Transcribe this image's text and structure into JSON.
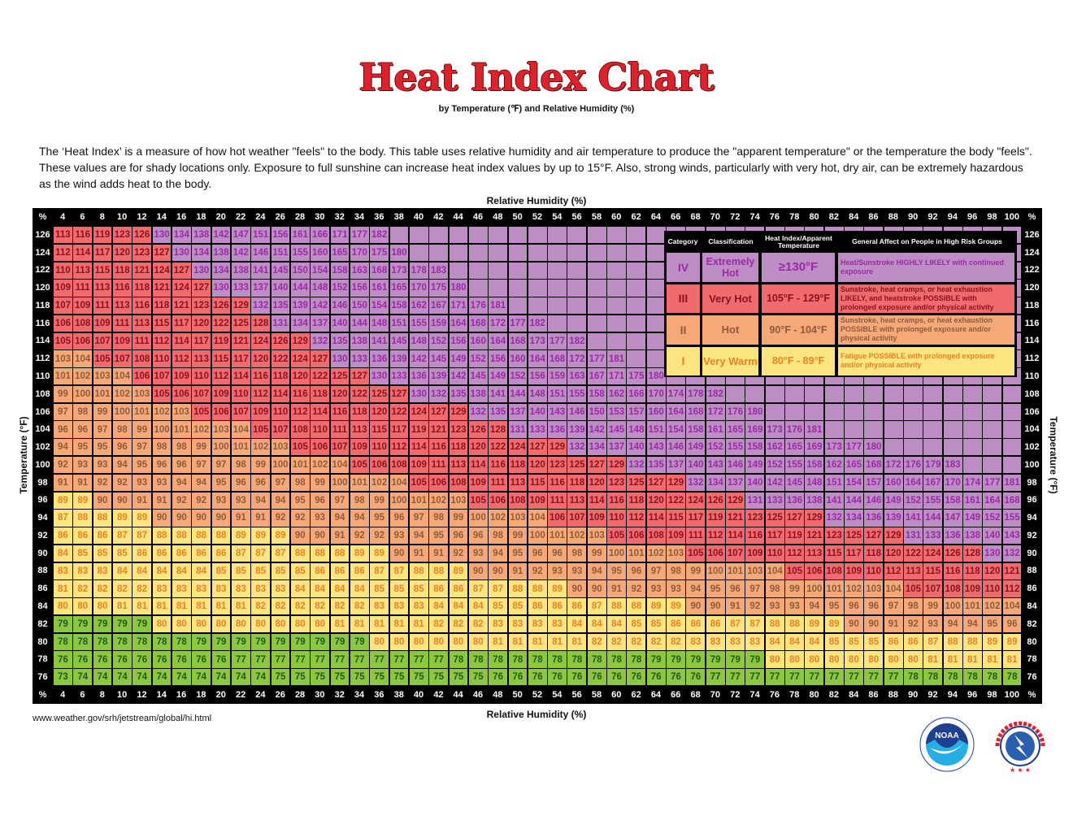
{
  "title": "Heat Index Chart",
  "subtitle": "by Temperature (℉) and Relative Humidity (%)",
  "intro": "The ‘Heat Index’ is a measure of how hot weather \"feels\" to the body. This table uses relative humidity and air temperature to produce the \"apparent temperature\" or the temperature the body \"feels\". These values are for shady locations only. Exposure to full sunshine can increase heat index values by up to 15°F. Also, strong winds, particularly with very hot, dry air, can be extremely hazardous as the wind adds heat to the body.",
  "source_url": "www.weather.gov/srh/jetstream/global/hi.html",
  "logos": {
    "noaa": "NOAA",
    "noaa_ring": "NATIONAL OCEANIC AND ATMOSPHERIC ADMINISTRATION · U.S. DEPARTMENT OF COMMERCE",
    "nws": "NATIONAL WEATHER SERVICE"
  },
  "colors": {
    "extremely_hot": "#bf8dc6",
    "very_hot": "#ef6b6e",
    "hot": "#f5a978",
    "very_warm": "#fce480",
    "below": "#8dc641"
  },
  "legend": {
    "headers": [
      "Category",
      "Classification",
      "Heat Index/Apparent Temperature",
      "General Affect on People in High Risk Groups"
    ],
    "rows": [
      {
        "category": "IV",
        "classification": "Extremely Hot",
        "range": "≥130°F",
        "effect": "Heat/Sunstroke HIGHLY LIKELY with continued exposure",
        "color": "purple"
      },
      {
        "category": "III",
        "classification": "Very Hot",
        "range": "105°F - 129°F",
        "effect": "Sunstroke, heat cramps, or heat exhaustion LIKELY, and heatstroke POSSIBLE with prolonged exposure and/or physical activity",
        "color": "red"
      },
      {
        "category": "II",
        "classification": "Hot",
        "range": "90°F - 104°F",
        "effect": "Sunstroke, heat cramps, or heat exhaustion POSSIBLE with prolonged exposure and/or physical activity",
        "color": "orange"
      },
      {
        "category": "I",
        "classification": "Very Warm",
        "range": "80°F - 89°F",
        "effect": "Fatigue POSSIBLE with prolonged exposure and/or physical activity",
        "color": "yellow"
      }
    ]
  },
  "chart_data": {
    "type": "heatmap",
    "title": "Heat Index Chart",
    "subtitle": "by Temperature (℉) and Relative Humidity (%)",
    "xlabel": "Relative Humidity (%)",
    "ylabel": "Temperature (°F)",
    "corner_label": "%",
    "humidity": [
      4,
      6,
      8,
      10,
      12,
      14,
      16,
      18,
      20,
      22,
      24,
      26,
      28,
      30,
      32,
      34,
      36,
      38,
      40,
      42,
      44,
      46,
      48,
      50,
      52,
      54,
      56,
      58,
      60,
      62,
      64,
      66,
      68,
      70,
      72,
      74,
      76,
      78,
      80,
      82,
      84,
      86,
      88,
      90,
      92,
      94,
      96,
      98,
      100
    ],
    "rows": [
      {
        "temp": 126,
        "values": [
          113,
          116,
          119,
          123,
          126,
          130,
          134,
          138,
          142,
          147,
          151,
          156,
          161,
          166,
          171,
          177,
          182
        ]
      },
      {
        "temp": 124,
        "values": [
          112,
          114,
          117,
          120,
          123,
          127,
          130,
          134,
          138,
          142,
          146,
          151,
          155,
          160,
          165,
          170,
          175,
          180
        ]
      },
      {
        "temp": 122,
        "values": [
          110,
          113,
          115,
          118,
          121,
          124,
          127,
          130,
          134,
          138,
          141,
          145,
          150,
          154,
          158,
          163,
          168,
          173,
          178,
          183
        ]
      },
      {
        "temp": 120,
        "values": [
          109,
          111,
          113,
          116,
          118,
          121,
          124,
          127,
          130,
          133,
          137,
          140,
          144,
          148,
          152,
          156,
          161,
          165,
          170,
          175,
          180
        ]
      },
      {
        "temp": 118,
        "values": [
          107,
          109,
          111,
          113,
          116,
          118,
          121,
          123,
          126,
          129,
          132,
          135,
          139,
          142,
          146,
          150,
          154,
          158,
          162,
          167,
          171,
          176,
          181
        ]
      },
      {
        "temp": 116,
        "values": [
          106,
          108,
          109,
          111,
          113,
          115,
          117,
          120,
          122,
          125,
          128,
          131,
          134,
          137,
          140,
          144,
          148,
          151,
          155,
          159,
          164,
          168,
          172,
          177,
          182
        ]
      },
      {
        "temp": 114,
        "values": [
          105,
          106,
          107,
          109,
          111,
          112,
          114,
          117,
          119,
          121,
          124,
          126,
          129,
          132,
          135,
          138,
          141,
          145,
          148,
          152,
          156,
          160,
          164,
          168,
          173,
          177,
          182
        ]
      },
      {
        "temp": 112,
        "values": [
          103,
          104,
          105,
          107,
          108,
          110,
          112,
          113,
          115,
          117,
          120,
          122,
          124,
          127,
          130,
          133,
          136,
          139,
          142,
          145,
          149,
          152,
          156,
          160,
          164,
          168,
          172,
          177,
          181
        ]
      },
      {
        "temp": 110,
        "values": [
          101,
          102,
          103,
          104,
          106,
          107,
          109,
          110,
          112,
          114,
          116,
          118,
          120,
          122,
          125,
          127,
          130,
          133,
          136,
          139,
          142,
          145,
          149,
          152,
          156,
          159,
          163,
          167,
          171,
          175,
          180
        ]
      },
      {
        "temp": 108,
        "values": [
          99,
          100,
          101,
          102,
          103,
          105,
          106,
          107,
          109,
          110,
          112,
          114,
          116,
          118,
          120,
          122,
          125,
          127,
          130,
          132,
          135,
          138,
          141,
          144,
          148,
          151,
          155,
          158,
          162,
          166,
          170,
          174,
          178,
          182
        ]
      },
      {
        "temp": 106,
        "values": [
          97,
          98,
          99,
          100,
          101,
          102,
          103,
          105,
          106,
          107,
          109,
          110,
          112,
          114,
          116,
          118,
          120,
          122,
          124,
          127,
          129,
          132,
          135,
          137,
          140,
          143,
          146,
          150,
          153,
          157,
          160,
          164,
          168,
          172,
          176,
          180
        ]
      },
      {
        "temp": 104,
        "values": [
          96,
          96,
          97,
          98,
          99,
          100,
          101,
          102,
          103,
          104,
          105,
          107,
          108,
          110,
          111,
          113,
          115,
          117,
          119,
          121,
          123,
          126,
          128,
          131,
          133,
          136,
          139,
          142,
          145,
          148,
          151,
          154,
          158,
          161,
          165,
          169,
          173,
          176,
          181
        ]
      },
      {
        "temp": 102,
        "values": [
          94,
          95,
          95,
          96,
          97,
          98,
          98,
          99,
          100,
          101,
          102,
          103,
          105,
          106,
          107,
          109,
          110,
          112,
          114,
          116,
          118,
          120,
          122,
          124,
          127,
          129,
          132,
          134,
          137,
          140,
          143,
          146,
          149,
          152,
          155,
          158,
          162,
          165,
          169,
          173,
          177,
          180
        ]
      },
      {
        "temp": 100,
        "values": [
          92,
          93,
          93,
          94,
          95,
          96,
          96,
          97,
          97,
          98,
          99,
          100,
          101,
          102,
          104,
          105,
          106,
          108,
          109,
          111,
          113,
          114,
          116,
          118,
          120,
          123,
          125,
          127,
          129,
          132,
          135,
          137,
          140,
          143,
          146,
          149,
          152,
          155,
          158,
          162,
          165,
          168,
          172,
          176,
          179,
          183
        ]
      },
      {
        "temp": 98,
        "values": [
          91,
          91,
          92,
          92,
          93,
          93,
          94,
          94,
          95,
          96,
          96,
          97,
          98,
          99,
          100,
          101,
          102,
          104,
          105,
          106,
          108,
          109,
          111,
          113,
          115,
          116,
          118,
          120,
          123,
          125,
          127,
          129,
          132,
          134,
          137,
          140,
          142,
          145,
          148,
          151,
          154,
          157,
          160,
          164,
          167,
          170,
          174,
          177,
          181
        ]
      },
      {
        "temp": 96,
        "values": [
          89,
          89,
          90,
          90,
          91,
          91,
          92,
          92,
          93,
          93,
          94,
          94,
          95,
          96,
          97,
          98,
          99,
          100,
          101,
          102,
          103,
          105,
          106,
          108,
          109,
          111,
          113,
          114,
          116,
          118,
          120,
          122,
          124,
          126,
          129,
          131,
          133,
          136,
          138,
          141,
          144,
          146,
          149,
          152,
          155,
          158,
          161,
          164,
          168
        ]
      },
      {
        "temp": 94,
        "values": [
          87,
          88,
          88,
          89,
          89,
          90,
          90,
          90,
          90,
          91,
          91,
          92,
          92,
          93,
          94,
          94,
          95,
          96,
          97,
          98,
          99,
          100,
          102,
          103,
          104,
          106,
          107,
          109,
          110,
          112,
          114,
          115,
          117,
          119,
          121,
          123,
          125,
          127,
          129,
          132,
          134,
          136,
          139,
          141,
          144,
          147,
          149,
          152,
          155
        ]
      },
      {
        "temp": 92,
        "values": [
          86,
          86,
          86,
          87,
          87,
          88,
          88,
          88,
          88,
          89,
          89,
          89,
          90,
          90,
          91,
          92,
          92,
          93,
          94,
          95,
          96,
          96,
          98,
          99,
          100,
          101,
          102,
          103,
          105,
          106,
          108,
          109,
          111,
          112,
          114,
          116,
          117,
          119,
          121,
          123,
          125,
          127,
          129,
          131,
          133,
          136,
          138,
          140,
          143
        ]
      },
      {
        "temp": 90,
        "values": [
          84,
          85,
          85,
          85,
          86,
          86,
          86,
          86,
          86,
          87,
          87,
          87,
          88,
          88,
          88,
          89,
          89,
          90,
          91,
          91,
          92,
          93,
          94,
          95,
          96,
          96,
          98,
          99,
          100,
          101,
          102,
          103,
          105,
          106,
          107,
          109,
          110,
          112,
          113,
          115,
          117,
          118,
          120,
          122,
          124,
          126,
          128,
          130,
          132
        ]
      },
      {
        "temp": 88,
        "values": [
          83,
          83,
          83,
          84,
          84,
          84,
          84,
          84,
          85,
          85,
          85,
          85,
          85,
          86,
          86,
          86,
          87,
          87,
          88,
          88,
          89,
          90,
          90,
          91,
          92,
          93,
          93,
          94,
          95,
          96,
          97,
          98,
          99,
          100,
          101,
          103,
          104,
          105,
          106,
          108,
          109,
          110,
          112,
          113,
          115,
          116,
          118,
          120,
          121
        ]
      },
      {
        "temp": 86,
        "values": [
          81,
          82,
          82,
          82,
          82,
          83,
          83,
          83,
          83,
          83,
          83,
          83,
          84,
          84,
          84,
          84,
          85,
          85,
          85,
          86,
          86,
          87,
          87,
          88,
          88,
          89,
          90,
          90,
          91,
          92,
          93,
          93,
          94,
          95,
          96,
          97,
          98,
          99,
          100,
          101,
          102,
          103,
          104,
          105,
          107,
          108,
          109,
          110,
          112
        ]
      },
      {
        "temp": 84,
        "values": [
          80,
          80,
          80,
          81,
          81,
          81,
          81,
          81,
          81,
          81,
          82,
          82,
          82,
          82,
          82,
          82,
          83,
          83,
          83,
          84,
          84,
          84,
          85,
          85,
          86,
          86,
          86,
          87,
          88,
          88,
          89,
          89,
          90,
          90,
          91,
          92,
          93,
          93,
          94,
          95,
          96,
          96,
          97,
          98,
          99,
          100,
          101,
          102,
          104
        ]
      },
      {
        "temp": 82,
        "values": [
          79,
          79,
          79,
          79,
          79,
          80,
          80,
          80,
          80,
          80,
          80,
          80,
          80,
          80,
          81,
          81,
          81,
          81,
          81,
          82,
          82,
          82,
          83,
          83,
          83,
          83,
          84,
          84,
          84,
          85,
          85,
          86,
          86,
          86,
          87,
          87,
          88,
          88,
          89,
          89,
          90,
          90,
          91,
          92,
          93,
          94,
          94,
          95,
          96
        ]
      },
      {
        "temp": 80,
        "values": [
          78,
          78,
          78,
          78,
          78,
          78,
          78,
          79,
          79,
          79,
          79,
          79,
          79,
          79,
          79,
          79,
          80,
          80,
          80,
          80,
          80,
          80,
          81,
          81,
          81,
          81,
          81,
          82,
          82,
          82,
          82,
          82,
          83,
          83,
          83,
          83,
          84,
          84,
          84,
          85,
          85,
          85,
          86,
          86,
          87,
          88,
          88,
          89,
          89
        ]
      },
      {
        "temp": 78,
        "values": [
          76,
          76,
          76,
          76,
          76,
          76,
          76,
          76,
          76,
          77,
          77,
          77,
          77,
          77,
          77,
          77,
          77,
          77,
          77,
          77,
          78,
          78,
          78,
          78,
          78,
          78,
          78,
          78,
          78,
          78,
          79,
          79,
          79,
          79,
          79,
          79,
          80,
          80,
          80,
          80,
          80,
          80,
          80,
          80,
          81,
          81,
          81,
          81,
          81
        ]
      },
      {
        "temp": 76,
        "values": [
          73,
          74,
          74,
          74,
          74,
          74,
          74,
          74,
          74,
          74,
          74,
          75,
          75,
          75,
          75,
          75,
          75,
          75,
          75,
          75,
          75,
          75,
          76,
          76,
          76,
          76,
          76,
          76,
          76,
          76,
          76,
          76,
          76,
          77,
          77,
          77,
          77,
          77,
          77,
          77,
          77,
          77,
          77,
          78,
          78,
          78,
          78,
          78,
          78
        ]
      }
    ],
    "color_thresholds": {
      "green_below": 80,
      "yellow_from": 80,
      "orange_from": 90,
      "red_from": 105,
      "purple_from": 130
    }
  }
}
